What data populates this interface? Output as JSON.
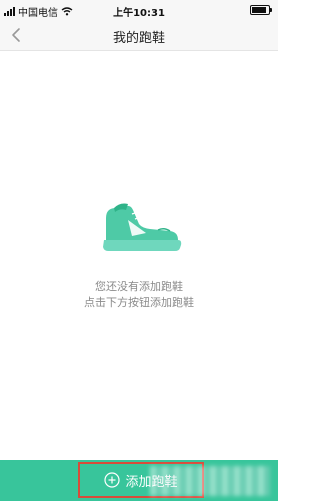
{
  "status_bar": {
    "carrier": "中国电信",
    "time": "上午10:31"
  },
  "nav": {
    "title": "我的跑鞋"
  },
  "empty_state": {
    "line1": "您还没有添加跑鞋",
    "line2": "点击下方按钮添加跑鞋",
    "icon": "running-shoe-icon"
  },
  "bottom": {
    "add_label": "添加跑鞋"
  },
  "colors": {
    "accent": "#38c59b",
    "highlight_box": "#d94b3a"
  }
}
